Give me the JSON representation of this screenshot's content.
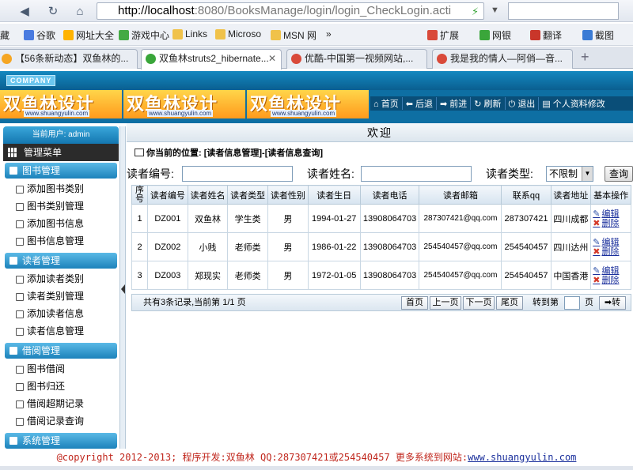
{
  "browser": {
    "url_host": "http://localhost",
    "url_rest": ":8080/BooksManage/login/login_CheckLogin.acti",
    "bookmarks": [
      "藏",
      "谷歌",
      "网址大全",
      "游戏中心",
      "Links",
      "Microso",
      "MSN 网",
      "»",
      "扩展",
      "网银",
      "翻译",
      "截图"
    ],
    "tabs": [
      {
        "title": "【56条新动态】双鱼林的..."
      },
      {
        "title": "双鱼林struts2_hibernate..."
      },
      {
        "title": "优酷-中国第一视频网站,..."
      },
      {
        "title": "我是我的情人—阿俏—音..."
      }
    ]
  },
  "header": {
    "company": "COMPANY",
    "banner_text": "双鱼林设计",
    "banner_url": "www.shuangyulin.com",
    "toolbar": [
      "首页",
      "后退",
      "前进",
      "刷新",
      "退出",
      "个人资料修改"
    ]
  },
  "sidebar": {
    "user_label": "当前用户: admin",
    "menu_title": "管理菜单",
    "groups": [
      {
        "title": "图书管理",
        "items": [
          "添加图书类别",
          "图书类别管理",
          "添加图书信息",
          "图书信息管理"
        ]
      },
      {
        "title": "读者管理",
        "items": [
          "添加读者类别",
          "读者类别管理",
          "添加读者信息",
          "读者信息管理"
        ]
      },
      {
        "title": "借阅管理",
        "items": [
          "图书借阅",
          "图书归还",
          "借阅超期记录",
          "借阅记录查询"
        ]
      },
      {
        "title": "系统管理",
        "items": []
      }
    ]
  },
  "main": {
    "welcome": "欢迎",
    "position": "你当前的位置: [读者信息管理]-[读者信息查询]",
    "search": {
      "reader_no_label": "读者编号:",
      "reader_name_label": "读者姓名:",
      "reader_type_label": "读者类型:",
      "reader_type_value": "不限制",
      "button": "查询"
    },
    "table": {
      "headers": [
        "序号",
        "读者编号",
        "读者姓名",
        "读者类型",
        "读者性别",
        "读者生日",
        "读者电话",
        "读者邮箱",
        "联系qq",
        "读者地址",
        "基本操作"
      ],
      "rows": [
        [
          "1",
          "DZ001",
          "双鱼林",
          "学生类",
          "男",
          "1994-01-27",
          "13908064703",
          "287307421@qq.com",
          "287307421",
          "四川成都"
        ],
        [
          "2",
          "DZ002",
          "小贱",
          "老师类",
          "男",
          "1986-01-22",
          "13908064703",
          "254540457@qq.com",
          "254540457",
          "四川达州"
        ],
        [
          "3",
          "DZ003",
          "郑现实",
          "老师类",
          "男",
          "1972-01-05",
          "13908064703",
          "254540457@qq.com",
          "254540457",
          "中国香港"
        ]
      ],
      "edit_label": "编辑",
      "delete_label": "删除"
    },
    "pager": {
      "summary": "共有3条记录,当前第 1/1 页",
      "buttons": [
        "首页",
        "上一页",
        "下一页",
        "尾页"
      ],
      "goto_label": "转到第",
      "page_suffix": "页",
      "go_button": "➡转"
    }
  },
  "footer": {
    "text": "@copyright 2012-2013; 程序开发:双鱼林  QQ:287307421或254540457  更多系统到网站:",
    "link": "www.shuangyulin.com"
  }
}
